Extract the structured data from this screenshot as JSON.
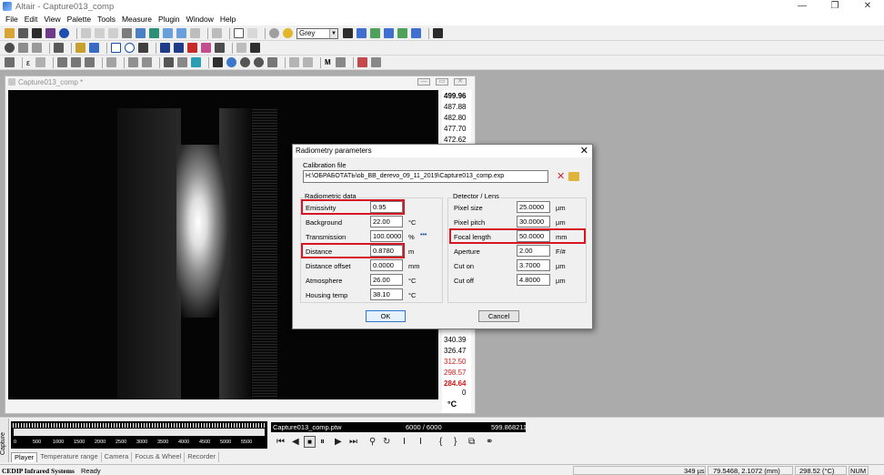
{
  "app": {
    "title": "Altair - Capture013_comp",
    "window_controls": [
      "—",
      "❐",
      "✕"
    ]
  },
  "menu": [
    "File",
    "Edit",
    "View",
    "Palette",
    "Tools",
    "Measure",
    "Plugin",
    "Window",
    "Help"
  ],
  "toolbar": {
    "palette_value": "Grey",
    "small_glyph": "ε",
    "m_glyph": "M"
  },
  "image_window": {
    "title": "Capture013_comp *",
    "buttons": [
      "—",
      "▭",
      "✕"
    ]
  },
  "scale": {
    "values": [
      {
        "v": "499.96",
        "bold": true,
        "color": "#000000"
      },
      {
        "v": "487.88",
        "bold": false,
        "color": "#000000"
      },
      {
        "v": "482.80",
        "bold": false,
        "color": "#000000"
      },
      {
        "v": "477.70",
        "bold": false,
        "color": "#000000"
      },
      {
        "v": "472.62",
        "bold": false,
        "color": "#000000"
      },
      {
        "v": "340.39",
        "bold": false,
        "color": "#000000"
      },
      {
        "v": "326.47",
        "bold": false,
        "color": "#000000"
      },
      {
        "v": "312.50",
        "bold": false,
        "color": "#d11a1a"
      },
      {
        "v": "298.57",
        "bold": false,
        "color": "#d11a1a"
      },
      {
        "v": "284.64",
        "bold": true,
        "color": "#d11a1a"
      }
    ],
    "zero": "0",
    "unit": "°C"
  },
  "dialog": {
    "title": "Radiometry parameters",
    "close": "✕",
    "calibration_label": "Calibration file",
    "calibration_path": "H:\\ОБРАБОТАТЬ\\ob_BB_derevo_09_11_2019\\Capture013_comp.exp",
    "radiometric_label": "Radiometric data",
    "detector_label": "Detector / Lens",
    "ellipsis": "•••",
    "radiometric": [
      {
        "label": "Emissivity",
        "value": "0.95",
        "unit": ""
      },
      {
        "label": "Background",
        "value": "22.00",
        "unit": "°C"
      },
      {
        "label": "Transmission",
        "value": "100.0000",
        "unit": "%"
      },
      {
        "label": "Distance",
        "value": "0.8780",
        "unit": "m"
      },
      {
        "label": "Distance offset",
        "value": "0.0000",
        "unit": "mm"
      },
      {
        "label": "Atmosphere",
        "value": "26.00",
        "unit": "°C"
      },
      {
        "label": "Housing temp",
        "value": "38.10",
        "unit": "°C"
      }
    ],
    "detector": [
      {
        "label": "Pixel size",
        "value": "25.0000",
        "unit": "µm"
      },
      {
        "label": "Pixel pitch",
        "value": "30.0000",
        "unit": "µm"
      },
      {
        "label": "Focal length",
        "value": "50.0000",
        "unit": "mm"
      },
      {
        "label": "Aperture",
        "value": "2.00",
        "unit": "F/#"
      },
      {
        "label": "Cut on",
        "value": "3.7000",
        "unit": "µm"
      },
      {
        "label": "Cut off",
        "value": "4.8000",
        "unit": "µm"
      }
    ],
    "ok": "OK",
    "cancel": "Cancel"
  },
  "player": {
    "ticks": [
      "0",
      "500",
      "1000",
      "1500",
      "2000",
      "2500",
      "3000",
      "3500",
      "4000",
      "4500",
      "5000",
      "5500"
    ],
    "file": "Capture013_comp.ptw",
    "frames": "6000 / 6000",
    "time": "599.868211",
    "capture_tab": "Capture",
    "tabs": [
      "Player",
      "Temperature range",
      "Camera",
      "Focus & Wheel",
      "Recorder"
    ]
  },
  "status": {
    "company": "CEDIP Infrared Systems",
    "state": "Ready",
    "exposure": "349 µs",
    "coords": "79.5468, 2.1072 (mm)",
    "temperature": "298.52 (°C)",
    "num": "NUM"
  },
  "colors": {
    "highlight": "#d51623",
    "workspace": "#ababab"
  }
}
